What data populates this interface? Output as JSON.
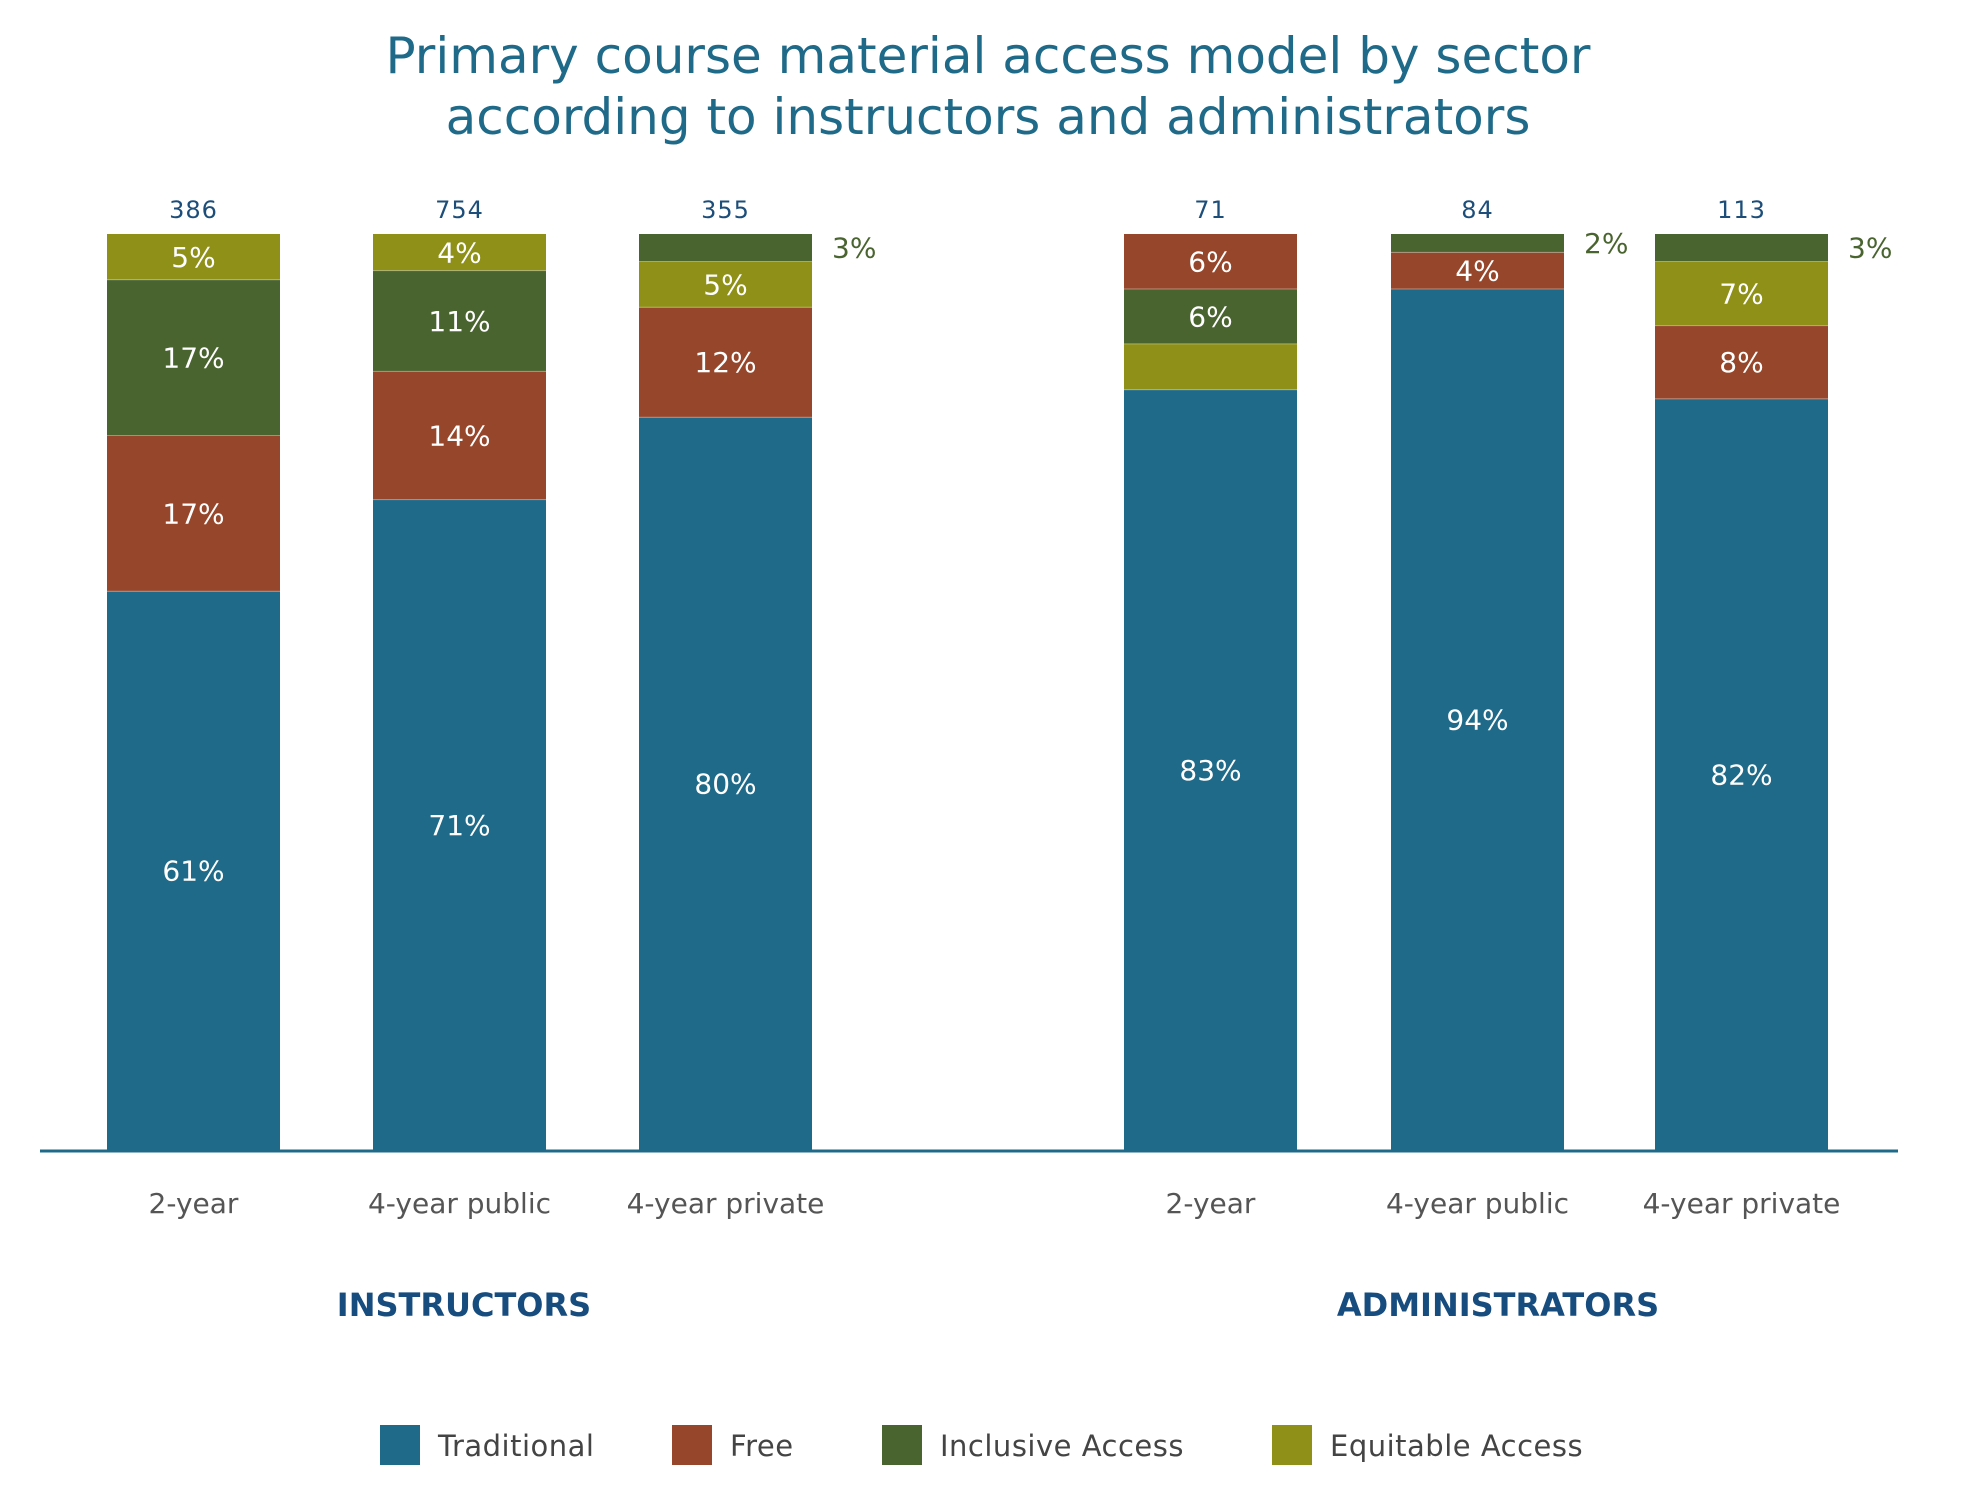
{
  "chart_data": {
    "type": "bar",
    "stacked": true,
    "title": [
      "Primary course material access model by sector",
      "according to instructors and administrators"
    ],
    "xlabel": "",
    "ylabel": "",
    "ylim": [
      0,
      100
    ],
    "grid": false,
    "legend_position": "bottom",
    "series_order": [
      "Traditional",
      "Free",
      "Inclusive Access",
      "Equitable Access"
    ],
    "colors": {
      "Traditional": "#1f6a88",
      "Free": "#96472b",
      "Inclusive Access": "#4a6430",
      "Equitable Access": "#8e9018",
      "axis": "#1f6a88"
    },
    "groups": [
      {
        "name": "INSTRUCTORS",
        "bars": [
          {
            "category": "2-year",
            "n": "386",
            "stack": [
              {
                "series": "Traditional",
                "value": 61,
                "label": "61%"
              },
              {
                "series": "Free",
                "value": 17,
                "label": "17%"
              },
              {
                "series": "Inclusive Access",
                "value": 17,
                "label": "17%"
              },
              {
                "series": "Equitable Access",
                "value": 5,
                "label": "5%"
              }
            ]
          },
          {
            "category": "4-year public",
            "n": "754",
            "stack": [
              {
                "series": "Traditional",
                "value": 71,
                "label": "71%"
              },
              {
                "series": "Free",
                "value": 14,
                "label": "14%"
              },
              {
                "series": "Inclusive Access",
                "value": 11,
                "label": "11%"
              },
              {
                "series": "Equitable Access",
                "value": 4,
                "label": "4%"
              }
            ]
          },
          {
            "category": "4-year private",
            "n": "355",
            "stack": [
              {
                "series": "Traditional",
                "value": 80,
                "label": "80%"
              },
              {
                "series": "Free",
                "value": 12,
                "label": "12%"
              },
              {
                "series": "Equitable Access",
                "value": 5,
                "label": "5%"
              },
              {
                "series": "Inclusive Access",
                "value": 3,
                "label": "3%",
                "outside": true
              }
            ]
          }
        ]
      },
      {
        "name": "ADMINISTRATORS",
        "bars": [
          {
            "category": "2-year",
            "n": "71",
            "stack": [
              {
                "series": "Traditional",
                "value": 83,
                "label": "83%"
              },
              {
                "series": "Equitable Access",
                "value": 5,
                "label": ""
              },
              {
                "series": "Inclusive Access",
                "value": 6,
                "label": "6%"
              },
              {
                "series": "Free",
                "value": 6,
                "label": "6%"
              }
            ]
          },
          {
            "category": "4-year public",
            "n": "84",
            "stack": [
              {
                "series": "Traditional",
                "value": 94,
                "label": "94%"
              },
              {
                "series": "Free",
                "value": 4,
                "label": "4%"
              },
              {
                "series": "Inclusive Access",
                "value": 2,
                "label": "2%",
                "outside": true
              }
            ]
          },
          {
            "category": "4-year private",
            "n": "113",
            "stack": [
              {
                "series": "Traditional",
                "value": 82,
                "label": "82%"
              },
              {
                "series": "Free",
                "value": 8,
                "label": "8%"
              },
              {
                "series": "Equitable Access",
                "value": 7,
                "label": "7%"
              },
              {
                "series": "Inclusive Access",
                "value": 3,
                "label": "3%",
                "outside": true
              }
            ]
          }
        ]
      }
    ],
    "legend": [
      {
        "label": "Traditional",
        "series": "Traditional"
      },
      {
        "label": "Free",
        "series": "Free"
      },
      {
        "label": "Inclusive Access",
        "series": "Inclusive Access"
      },
      {
        "label": "Equitable Access",
        "series": "Equitable Access"
      }
    ]
  }
}
